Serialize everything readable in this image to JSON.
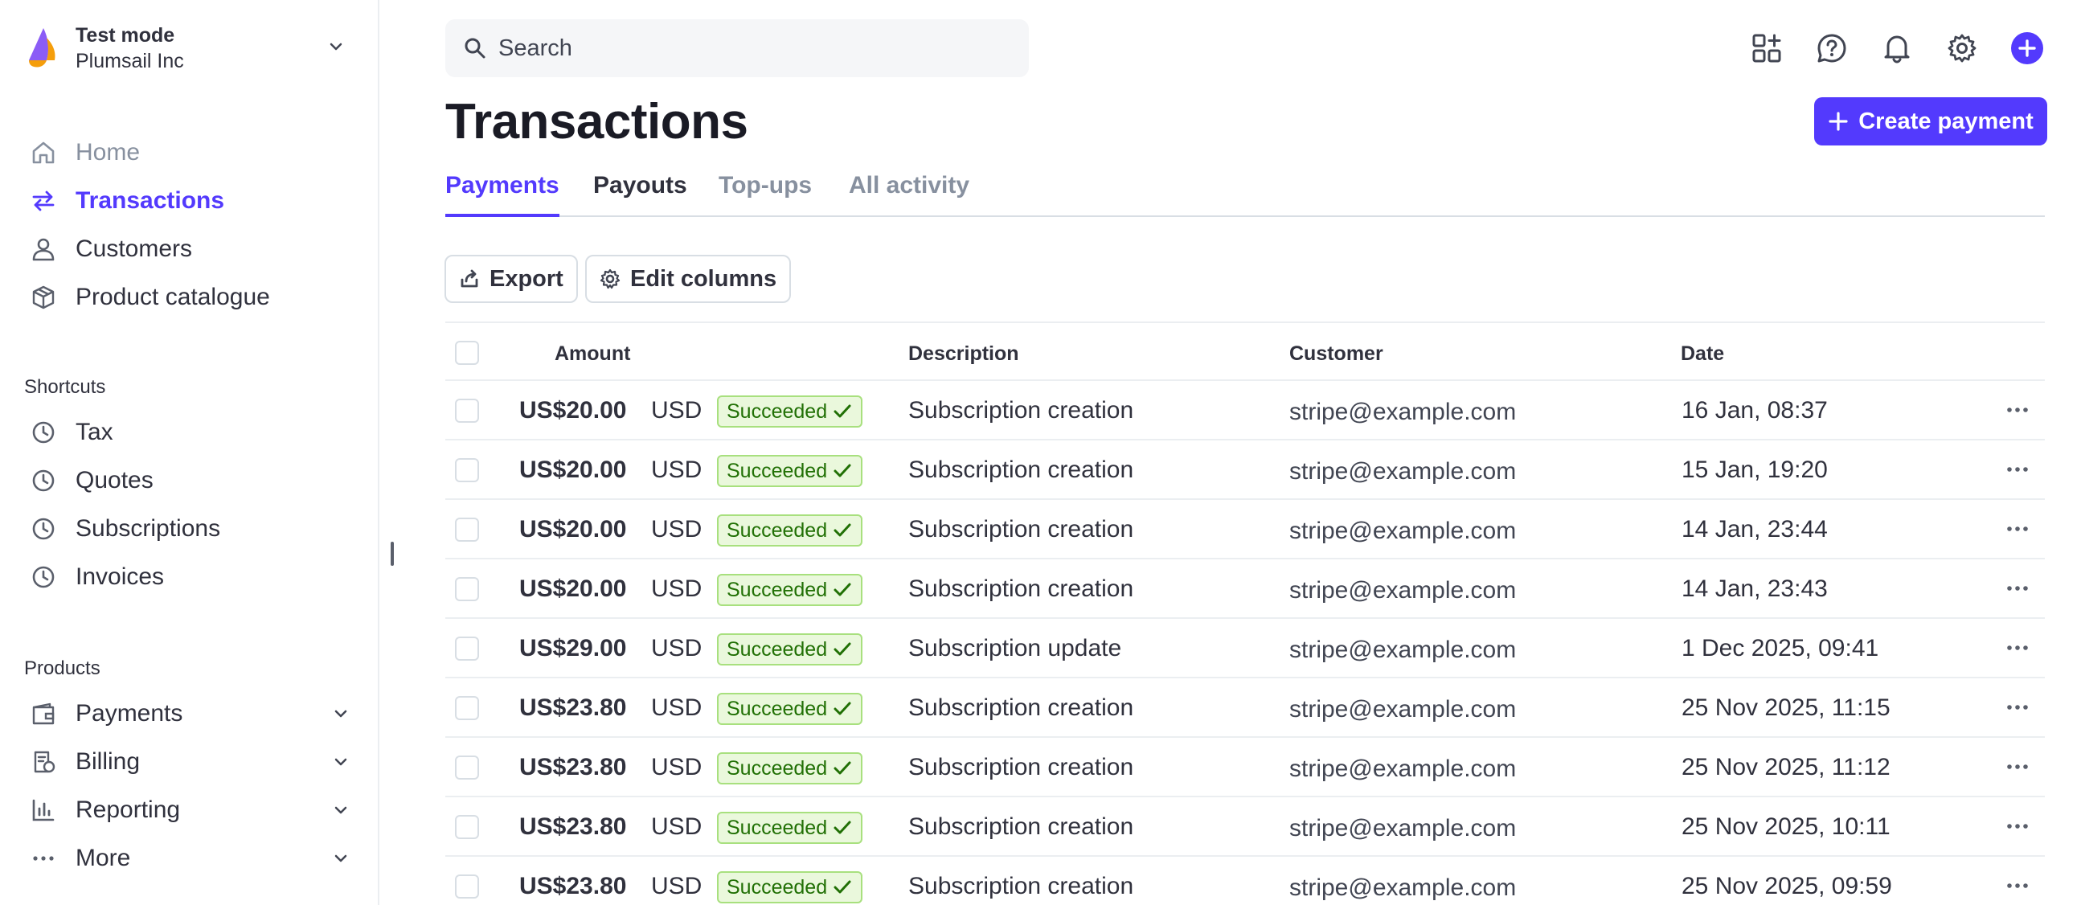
{
  "account": {
    "mode": "Test mode",
    "org": "Plumsail Inc"
  },
  "sidebar": {
    "nav": [
      {
        "label": "Home",
        "icon": "home-icon"
      },
      {
        "label": "Transactions",
        "icon": "arrows-swap-icon"
      },
      {
        "label": "Customers",
        "icon": "user-icon"
      },
      {
        "label": "Product catalogue",
        "icon": "box-icon"
      }
    ],
    "shortcuts_title": "Shortcuts",
    "shortcuts": [
      {
        "label": "Tax",
        "icon": "clock-icon"
      },
      {
        "label": "Quotes",
        "icon": "clock-icon"
      },
      {
        "label": "Subscriptions",
        "icon": "clock-icon"
      },
      {
        "label": "Invoices",
        "icon": "clock-icon"
      }
    ],
    "products_title": "Products",
    "products": [
      {
        "label": "Payments",
        "icon": "wallet-icon"
      },
      {
        "label": "Billing",
        "icon": "billing-icon"
      },
      {
        "label": "Reporting",
        "icon": "bar-chart-icon"
      },
      {
        "label": "More",
        "icon": "ellipsis-icon"
      }
    ]
  },
  "search": {
    "placeholder": "Search"
  },
  "page": {
    "title": "Transactions",
    "create_label": "Create payment",
    "tabs": [
      "Payments",
      "Payouts",
      "Top-ups",
      "All activity"
    ],
    "export_label": "Export",
    "edit_columns_label": "Edit columns"
  },
  "colors": {
    "accent": "#533afd",
    "success_bg": "#eaf8dc",
    "success_text": "#217005",
    "success_border": "#a8e07e"
  },
  "table": {
    "headers": {
      "amount": "Amount",
      "description": "Description",
      "customer": "Customer",
      "date": "Date"
    },
    "rows": [
      {
        "amount": "US$20.00",
        "currency": "USD",
        "status": "Succeeded",
        "description": "Subscription creation",
        "customer": "stripe@example.com",
        "date": "16 Jan, 08:37"
      },
      {
        "amount": "US$20.00",
        "currency": "USD",
        "status": "Succeeded",
        "description": "Subscription creation",
        "customer": "stripe@example.com",
        "date": "15 Jan, 19:20"
      },
      {
        "amount": "US$20.00",
        "currency": "USD",
        "status": "Succeeded",
        "description": "Subscription creation",
        "customer": "stripe@example.com",
        "date": "14 Jan, 23:44"
      },
      {
        "amount": "US$20.00",
        "currency": "USD",
        "status": "Succeeded",
        "description": "Subscription creation",
        "customer": "stripe@example.com",
        "date": "14 Jan, 23:43"
      },
      {
        "amount": "US$29.00",
        "currency": "USD",
        "status": "Succeeded",
        "description": "Subscription update",
        "customer": "stripe@example.com",
        "date": "1 Dec 2025, 09:41"
      },
      {
        "amount": "US$23.80",
        "currency": "USD",
        "status": "Succeeded",
        "description": "Subscription creation",
        "customer": "stripe@example.com",
        "date": "25 Nov 2025, 11:15"
      },
      {
        "amount": "US$23.80",
        "currency": "USD",
        "status": "Succeeded",
        "description": "Subscription creation",
        "customer": "stripe@example.com",
        "date": "25 Nov 2025, 11:12"
      },
      {
        "amount": "US$23.80",
        "currency": "USD",
        "status": "Succeeded",
        "description": "Subscription creation",
        "customer": "stripe@example.com",
        "date": "25 Nov 2025, 10:11"
      },
      {
        "amount": "US$23.80",
        "currency": "USD",
        "status": "Succeeded",
        "description": "Subscription creation",
        "customer": "stripe@example.com",
        "date": "25 Nov 2025, 09:59"
      }
    ]
  }
}
